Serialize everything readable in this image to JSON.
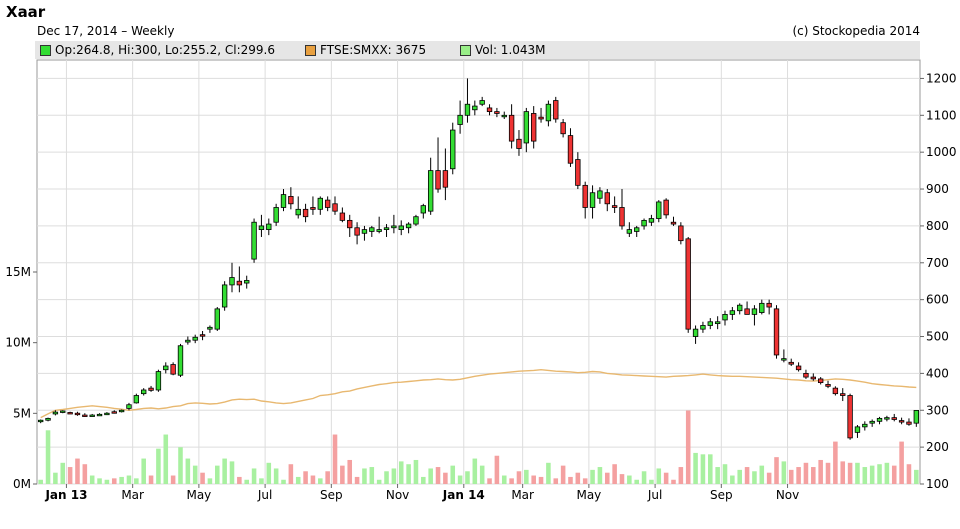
{
  "header": {
    "title": "Xaar",
    "subtitle": "Dec 17, 2014  – Weekly",
    "copyright": "(c) Stockopedia 2014"
  },
  "legend": [
    {
      "label": "Op:264.8, Hi:300, Lo:255.2, Cl:299.6",
      "color": "#33dd33"
    },
    {
      "label": "FTSE:SMXX: 3675",
      "color": "#e8a040"
    },
    {
      "label": "Vol: 1.043M",
      "color": "#99ee88"
    }
  ],
  "colors": {
    "up": "#33dd33",
    "down": "#ee3333",
    "index_line": "#e8b870",
    "vol_up": "#a8f0a0",
    "vol_down": "#f4a0a0",
    "grid": "#dddddd"
  },
  "chart_data": {
    "type": "candlestick",
    "price_axis": {
      "side": "right",
      "ylim": [
        100,
        1250
      ],
      "ticks": [
        "100",
        "200",
        "300",
        "400",
        "500",
        "600",
        "700",
        "800",
        "900",
        "1000",
        "1100",
        "1200"
      ]
    },
    "volume_axis": {
      "side": "left",
      "ylim": [
        0,
        30
      ],
      "ticks": [
        "0M",
        "5M",
        "10M",
        "15M"
      ],
      "unit": "M"
    },
    "x_ticks": [
      "Jan 13",
      "Mar",
      "May",
      "Jul",
      "Sep",
      "Nov",
      "Jan 14",
      "Mar",
      "May",
      "Jul",
      "Sep",
      "Nov"
    ],
    "x_tick_weeks": [
      4,
      13,
      22,
      31,
      40,
      49,
      58,
      66,
      75,
      84,
      93,
      102
    ],
    "grid": true,
    "candles": [
      [
        270,
        275,
        265,
        273
      ],
      [
        273,
        280,
        270,
        278
      ],
      [
        290,
        300,
        286,
        295
      ],
      [
        296,
        300,
        292,
        298
      ],
      [
        294,
        296,
        290,
        292
      ],
      [
        292,
        296,
        285,
        290
      ],
      [
        287,
        292,
        282,
        285
      ],
      [
        286,
        290,
        283,
        287
      ],
      [
        288,
        292,
        285,
        289
      ],
      [
        290,
        295,
        287,
        292
      ],
      [
        296,
        300,
        291,
        294
      ],
      [
        298,
        302,
        294,
        300
      ],
      [
        305,
        320,
        300,
        315
      ],
      [
        320,
        345,
        318,
        340
      ],
      [
        345,
        360,
        340,
        355
      ],
      [
        360,
        366,
        350,
        354
      ],
      [
        355,
        410,
        350,
        405
      ],
      [
        410,
        430,
        400,
        420
      ],
      [
        424,
        430,
        395,
        398
      ],
      [
        395,
        480,
        390,
        475
      ],
      [
        485,
        500,
        478,
        490
      ],
      [
        490,
        505,
        482,
        498
      ],
      [
        505,
        515,
        490,
        502
      ],
      [
        520,
        530,
        510,
        525
      ],
      [
        520,
        580,
        515,
        575
      ],
      [
        580,
        650,
        570,
        640
      ],
      [
        640,
        700,
        620,
        660
      ],
      [
        650,
        690,
        620,
        640
      ],
      [
        645,
        665,
        630,
        652
      ],
      [
        710,
        820,
        700,
        810
      ],
      [
        790,
        830,
        770,
        800
      ],
      [
        790,
        820,
        775,
        805
      ],
      [
        810,
        860,
        800,
        850
      ],
      [
        850,
        900,
        840,
        885
      ],
      [
        880,
        905,
        845,
        860
      ],
      [
        830,
        880,
        820,
        845
      ],
      [
        845,
        860,
        810,
        825
      ],
      [
        850,
        880,
        830,
        845
      ],
      [
        845,
        880,
        830,
        875
      ],
      [
        870,
        880,
        840,
        850
      ],
      [
        860,
        880,
        830,
        840
      ],
      [
        835,
        850,
        810,
        815
      ],
      [
        815,
        830,
        770,
        795
      ],
      [
        795,
        810,
        750,
        775
      ],
      [
        780,
        800,
        760,
        790
      ],
      [
        785,
        800,
        770,
        795
      ],
      [
        785,
        825,
        780,
        790
      ],
      [
        790,
        805,
        770,
        795
      ],
      [
        795,
        830,
        780,
        800
      ],
      [
        790,
        815,
        775,
        800
      ],
      [
        795,
        810,
        780,
        805
      ],
      [
        805,
        830,
        800,
        825
      ],
      [
        835,
        860,
        820,
        855
      ],
      [
        840,
        985,
        830,
        950
      ],
      [
        950,
        1040,
        890,
        900
      ],
      [
        950,
        1010,
        870,
        905
      ],
      [
        955,
        1080,
        940,
        1060
      ],
      [
        1075,
        1140,
        1050,
        1100
      ],
      [
        1100,
        1200,
        1080,
        1130
      ],
      [
        1115,
        1140,
        1100,
        1125
      ],
      [
        1130,
        1150,
        1125,
        1140
      ],
      [
        1120,
        1130,
        1100,
        1110
      ],
      [
        1110,
        1120,
        1095,
        1105
      ],
      [
        1100,
        1110,
        1090,
        1100
      ],
      [
        1100,
        1130,
        1010,
        1030
      ],
      [
        1035,
        1060,
        990,
        1010
      ],
      [
        1025,
        1120,
        1000,
        1110
      ],
      [
        1105,
        1125,
        1010,
        1030
      ],
      [
        1095,
        1120,
        1080,
        1090
      ],
      [
        1085,
        1140,
        1070,
        1130
      ],
      [
        1140,
        1150,
        1080,
        1090
      ],
      [
        1080,
        1090,
        1040,
        1050
      ],
      [
        1045,
        1065,
        960,
        970
      ],
      [
        980,
        1000,
        900,
        910
      ],
      [
        910,
        920,
        820,
        850
      ],
      [
        850,
        910,
        820,
        890
      ],
      [
        875,
        905,
        860,
        895
      ],
      [
        890,
        900,
        840,
        860
      ],
      [
        855,
        880,
        835,
        850
      ],
      [
        850,
        900,
        790,
        800
      ],
      [
        780,
        810,
        770,
        790
      ],
      [
        785,
        800,
        770,
        795
      ],
      [
        800,
        820,
        790,
        815
      ],
      [
        810,
        830,
        800,
        820
      ],
      [
        820,
        870,
        810,
        865
      ],
      [
        870,
        875,
        820,
        830
      ],
      [
        810,
        825,
        800,
        805
      ],
      [
        800,
        810,
        750,
        760
      ],
      [
        765,
        770,
        510,
        520
      ],
      [
        500,
        530,
        480,
        520
      ],
      [
        520,
        540,
        510,
        530
      ],
      [
        530,
        550,
        520,
        540
      ],
      [
        535,
        555,
        520,
        540
      ],
      [
        545,
        570,
        530,
        560
      ],
      [
        560,
        580,
        545,
        570
      ],
      [
        570,
        590,
        560,
        585
      ],
      [
        575,
        595,
        560,
        560
      ],
      [
        560,
        585,
        530,
        575
      ],
      [
        565,
        600,
        560,
        590
      ],
      [
        590,
        600,
        560,
        580
      ],
      [
        575,
        585,
        440,
        450
      ],
      [
        440,
        465,
        430,
        440
      ],
      [
        430,
        440,
        420,
        425
      ],
      [
        420,
        430,
        405,
        410
      ],
      [
        400,
        410,
        385,
        390
      ],
      [
        390,
        400,
        380,
        385
      ],
      [
        385,
        390,
        370,
        375
      ],
      [
        370,
        380,
        360,
        365
      ],
      [
        360,
        365,
        340,
        345
      ],
      [
        345,
        360,
        325,
        340
      ],
      [
        340,
        345,
        220,
        225
      ],
      [
        240,
        260,
        225,
        255
      ],
      [
        255,
        270,
        245,
        262
      ],
      [
        265,
        275,
        255,
        270
      ],
      [
        270,
        282,
        262,
        278
      ],
      [
        278,
        285,
        270,
        280
      ],
      [
        280,
        290,
        270,
        275
      ],
      [
        272,
        280,
        262,
        270
      ],
      [
        268,
        278,
        258,
        262
      ],
      [
        265,
        300,
        255,
        299.6
      ]
    ],
    "volume": [
      0.3,
      3.8,
      0.8,
      1.5,
      1.2,
      1.8,
      1.4,
      0.6,
      0.4,
      0.3,
      0.4,
      0.5,
      0.6,
      0.4,
      1.8,
      0.6,
      2.5,
      3.5,
      0.6,
      2.6,
      1.8,
      1.3,
      0.8,
      0.4,
      1.3,
      1.8,
      1.6,
      0.5,
      0.3,
      1.1,
      0.4,
      1.5,
      1.1,
      0.3,
      1.4,
      0.5,
      0.9,
      0.6,
      0.4,
      0.9,
      3.5,
      1.3,
      1.7,
      0.5,
      1.1,
      1.2,
      0.3,
      0.9,
      1.1,
      1.6,
      1.4,
      1.7,
      0.5,
      1.1,
      1.2,
      0.8,
      1.3,
      0.6,
      0.9,
      1.8,
      1.3,
      0.4,
      2.0,
      0.6,
      0.4,
      0.9,
      1.0,
      0.6,
      0.5,
      1.5,
      0.4,
      1.3,
      0.5,
      0.8,
      0.4,
      1.0,
      1.2,
      0.8,
      1.4,
      0.7,
      0.6,
      0.3,
      0.9,
      0.3,
      1.1,
      0.8,
      0.3,
      1.2,
      5.2,
      2.2,
      2.1,
      2.1,
      1.2,
      1.4,
      0.6,
      1.0,
      1.2,
      0.9,
      1.3,
      0.8,
      1.9,
      1.6,
      1.0,
      1.2,
      1.5,
      1.2,
      1.7,
      1.5,
      3.0,
      1.6,
      1.5,
      1.5,
      1.2,
      1.3,
      1.4,
      1.5,
      1.3,
      3.0,
      1.4,
      1.0
    ],
    "index_series_name": "FTSE:SMXX",
    "index_line": [
      280,
      290,
      300,
      302,
      305,
      308,
      310,
      312,
      310,
      308,
      305,
      303,
      300,
      302,
      305,
      306,
      304,
      306,
      310,
      312,
      318,
      320,
      319,
      317,
      318,
      322,
      328,
      330,
      329,
      330,
      325,
      323,
      320,
      318,
      320,
      324,
      328,
      332,
      340,
      342,
      345,
      350,
      352,
      358,
      362,
      366,
      370,
      372,
      375,
      376,
      378,
      380,
      382,
      383,
      385,
      383,
      382,
      384,
      388,
      392,
      395,
      398,
      400,
      402,
      404,
      406,
      407,
      408,
      410,
      408,
      406,
      405,
      404,
      402,
      403,
      405,
      404,
      400,
      398,
      396,
      395,
      394,
      393,
      392,
      391,
      390,
      392,
      393,
      394,
      396,
      398,
      396,
      394,
      393,
      392,
      392,
      391,
      390,
      389,
      388,
      387,
      385,
      383,
      382,
      380,
      379,
      381,
      383,
      385,
      384,
      382,
      379,
      376,
      372,
      370,
      368,
      366,
      365,
      363,
      362
    ]
  }
}
